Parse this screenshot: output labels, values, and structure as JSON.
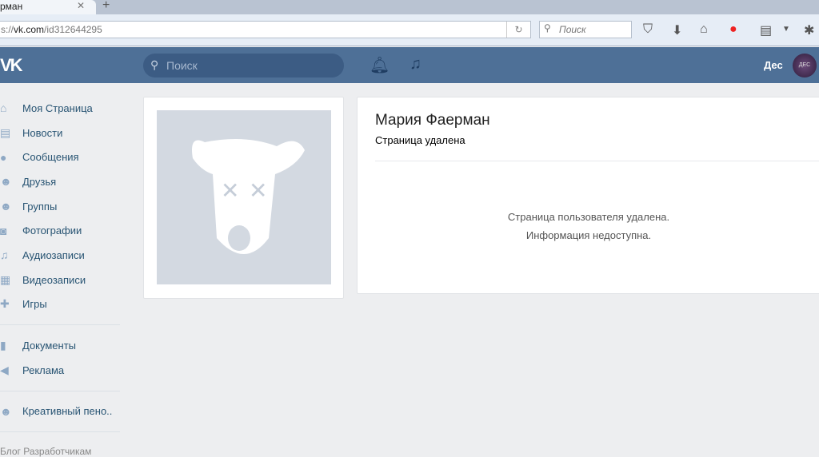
{
  "browser": {
    "tab_title": "рман",
    "url_prefix": "s://",
    "url_domain": "vk.com",
    "url_path": "/id312644295",
    "search_placeholder": "Поиск"
  },
  "header": {
    "search_placeholder": "Поиск",
    "user_name": "Дес",
    "avatar_text": "ДЕС"
  },
  "sidebar": {
    "items": [
      {
        "label": "Моя Страница",
        "icon": "⌂"
      },
      {
        "label": "Новости",
        "icon": "▤"
      },
      {
        "label": "Сообщения",
        "icon": "●"
      },
      {
        "label": "Друзья",
        "icon": "☻"
      },
      {
        "label": "Группы",
        "icon": "☻"
      },
      {
        "label": "Фотографии",
        "icon": "◙"
      },
      {
        "label": "Аудиозаписи",
        "icon": "♫"
      },
      {
        "label": "Видеозаписи",
        "icon": "▦"
      },
      {
        "label": "Игры",
        "icon": "✚"
      }
    ],
    "items2": [
      {
        "label": "Документы",
        "icon": "▮"
      },
      {
        "label": "Реклама",
        "icon": "◀"
      }
    ],
    "items3": [
      {
        "label": "Креативный пено..",
        "icon": "☻"
      }
    ],
    "footer": "Блог   Разработчикам"
  },
  "profile": {
    "name": "Мария Фаерман",
    "status": "Страница удалена",
    "message1": "Страница пользователя удалена.",
    "message2": "Информация недоступна."
  }
}
